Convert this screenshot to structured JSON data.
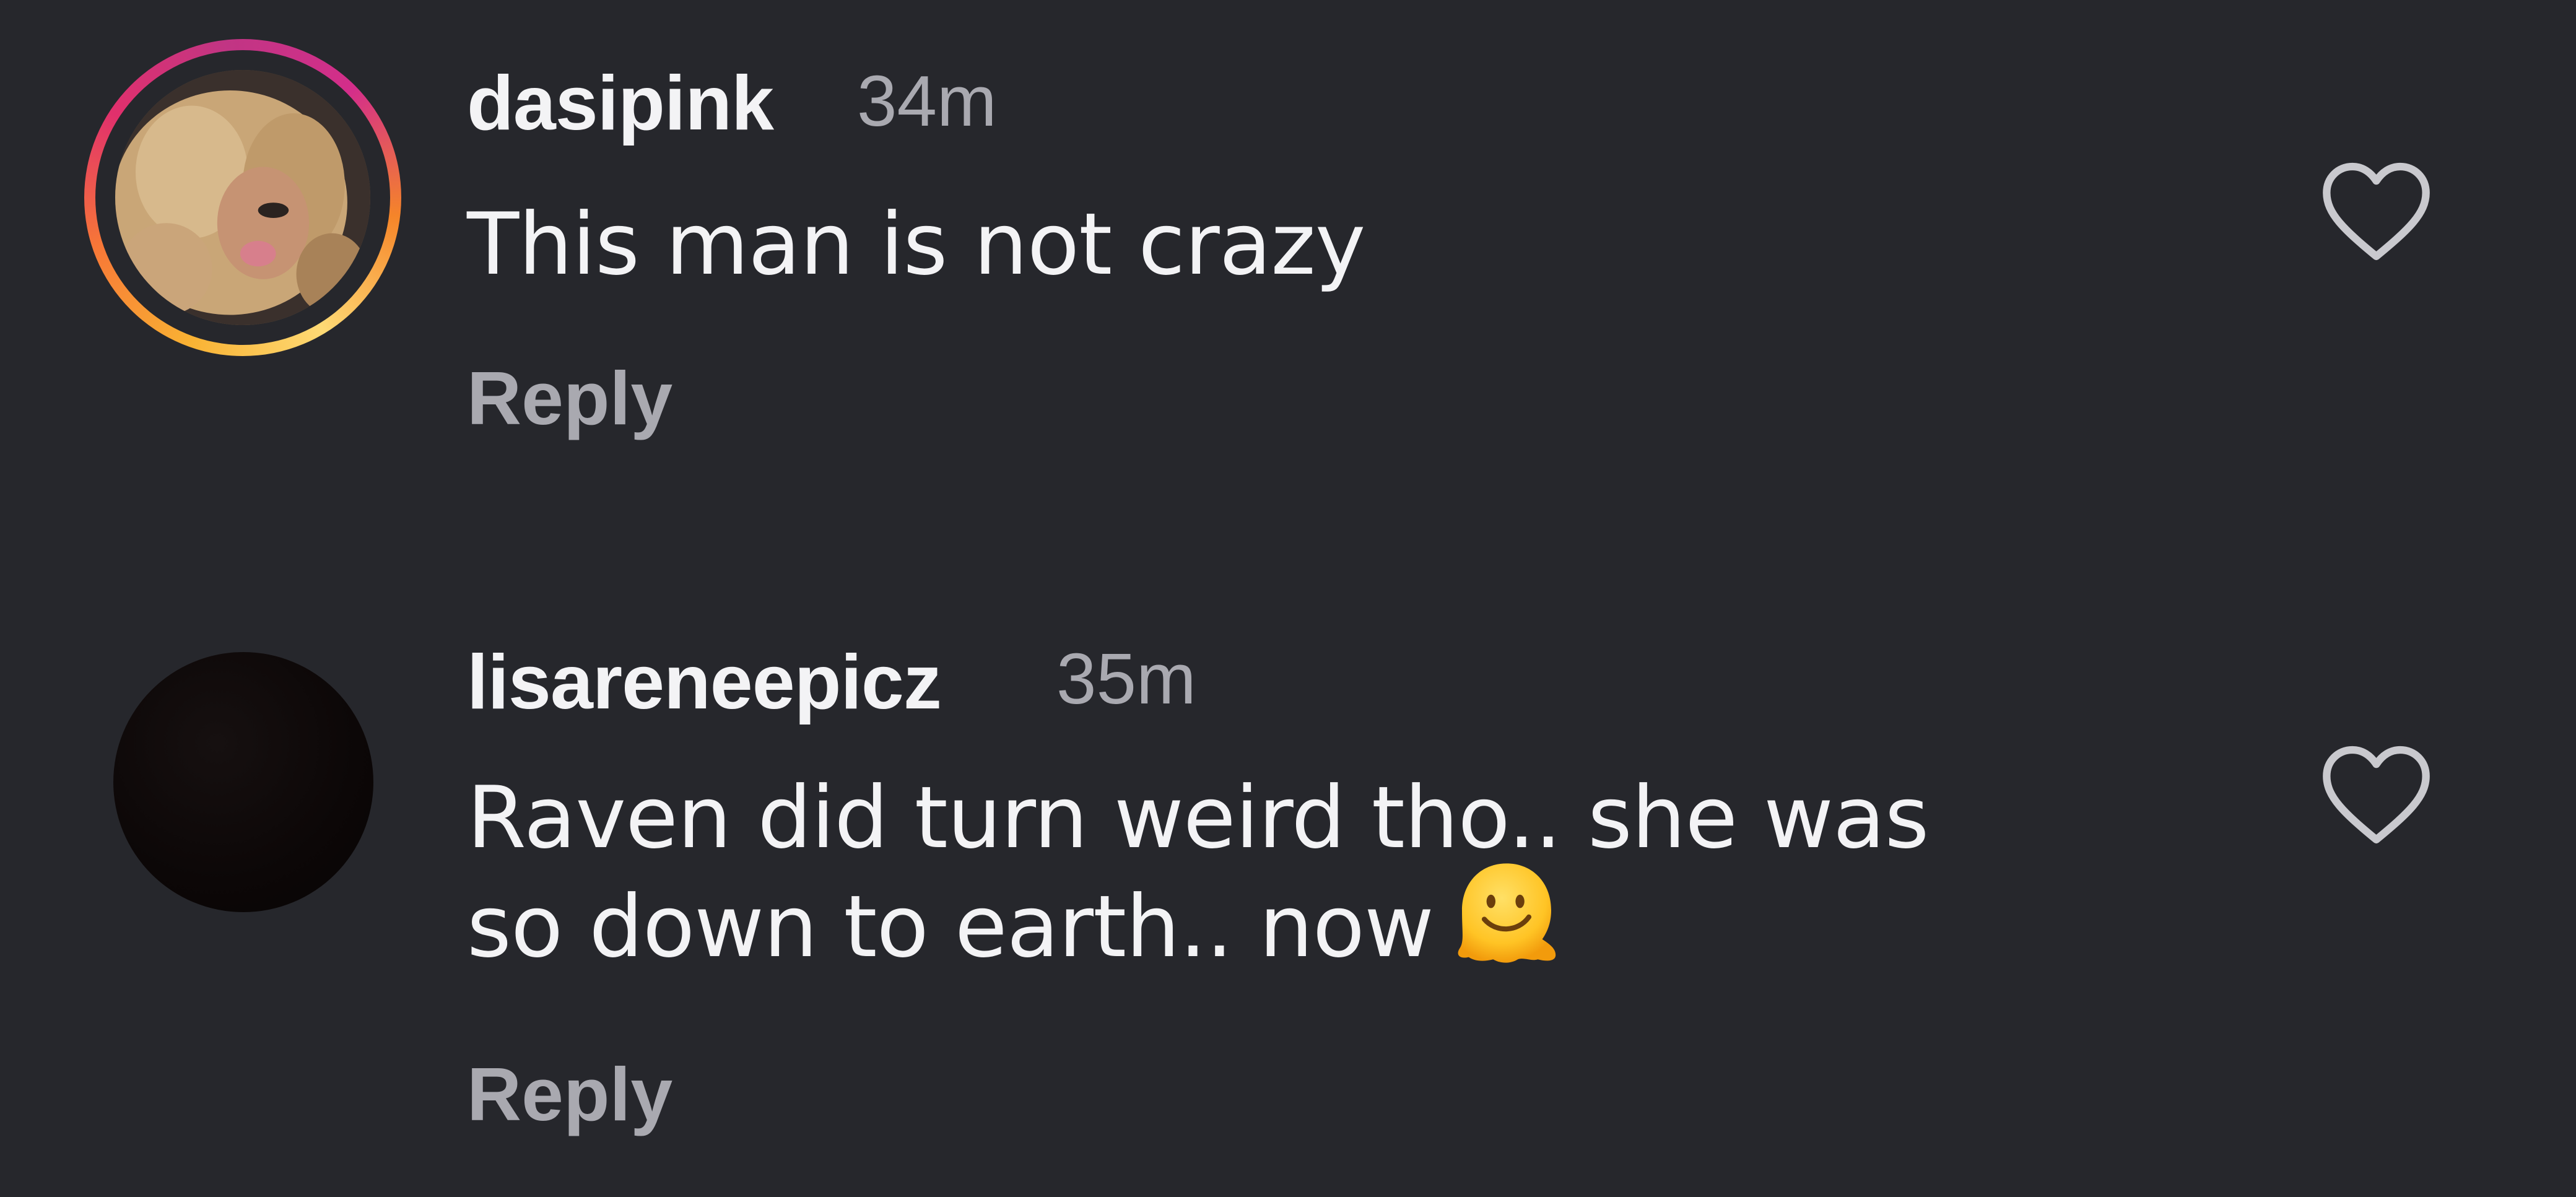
{
  "comments": [
    {
      "username": "dasipink",
      "time": "34m",
      "text_lines": [
        "This man is not crazy"
      ],
      "reply_label": "Reply",
      "avatar": "profile-photo-with-story-ring",
      "like_icon": "heart-outline-icon"
    },
    {
      "username": "lisareneepicz",
      "time": "35m",
      "text_lines": [
        "Raven did turn weird tho.. she was",
        "so down to earth.. now"
      ],
      "emoji": "melting-face-emoji",
      "reply_label": "Reply",
      "avatar": "dark-profile-photo",
      "like_icon": "heart-outline-icon"
    }
  ],
  "colors": {
    "background": "#26272c",
    "primary_text": "#f3f3f5",
    "secondary_text": "#a9a9b0",
    "story_ring_start": "#f9b233",
    "story_ring_end": "#d42e8a"
  }
}
